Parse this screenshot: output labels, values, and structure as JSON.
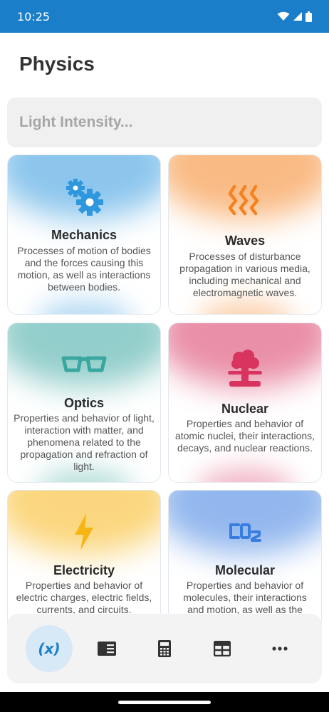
{
  "status": {
    "time": "10:25"
  },
  "page": {
    "title": "Physics"
  },
  "search": {
    "placeholder": "Light Intensity..."
  },
  "cards": [
    {
      "title": "Mechanics",
      "description": "Processes of motion of bodies and the forces causing this motion, as well as interactions between bodies.",
      "icon": "gears-icon",
      "accent": "#2e97de"
    },
    {
      "title": "Waves",
      "description": "Processes of disturbance propagation in various media, including mechanical and electromagnetic waves.",
      "icon": "waves-icon",
      "accent": "#f5821f"
    },
    {
      "title": "Optics",
      "description": "Properties and behavior of light, interaction with matter, and phenomena related to the propagation and refraction of light.",
      "icon": "glasses-icon",
      "accent": "#3aa6a0"
    },
    {
      "title": "Nuclear",
      "description": "Properties and behavior of atomic nuclei, their interactions, decays, and nuclear reactions.",
      "icon": "mushroom-cloud-icon",
      "accent": "#d8345f"
    },
    {
      "title": "Electricity",
      "description": "Properties and behavior of electric charges, electric fields, currents, and circuits.",
      "icon": "lightning-icon",
      "accent": "#f7b514"
    },
    {
      "title": "Molecular",
      "description": "Properties and behavior of molecules, their interactions and motion, as well as the",
      "icon": "co2-icon",
      "accent": "#3a7de0"
    }
  ],
  "nav": {
    "items": [
      {
        "icon": "variable-icon",
        "label": "(x)",
        "active": true
      },
      {
        "icon": "reader-icon"
      },
      {
        "icon": "calculator-icon"
      },
      {
        "icon": "table-icon"
      },
      {
        "icon": "more-icon"
      }
    ]
  }
}
